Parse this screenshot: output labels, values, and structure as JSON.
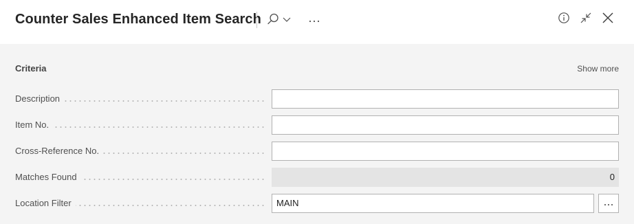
{
  "header": {
    "title": "Counter Sales Enhanced Item Search",
    "more_label": "···",
    "icons": [
      "search-icon",
      "chevron-down-icon",
      "ellipsis-icon",
      "info-icon",
      "collapse-icon",
      "close-icon"
    ]
  },
  "criteria": {
    "section_title": "Criteria",
    "show_more": "Show more",
    "fields": [
      {
        "label": "Description",
        "value": ""
      },
      {
        "label": "Item No.",
        "value": ""
      },
      {
        "label": "Cross-Reference No.",
        "value": ""
      },
      {
        "label": "Matches Found",
        "value": "0"
      },
      {
        "label": "Location Filter",
        "value": "MAIN"
      }
    ],
    "lookup_label": "···"
  },
  "colors": {
    "header_bg": "#ffffff",
    "content_bg": "#f4f4f4",
    "readonly_bg": "#e4e4e4",
    "input_border": "#b1b1b1"
  }
}
